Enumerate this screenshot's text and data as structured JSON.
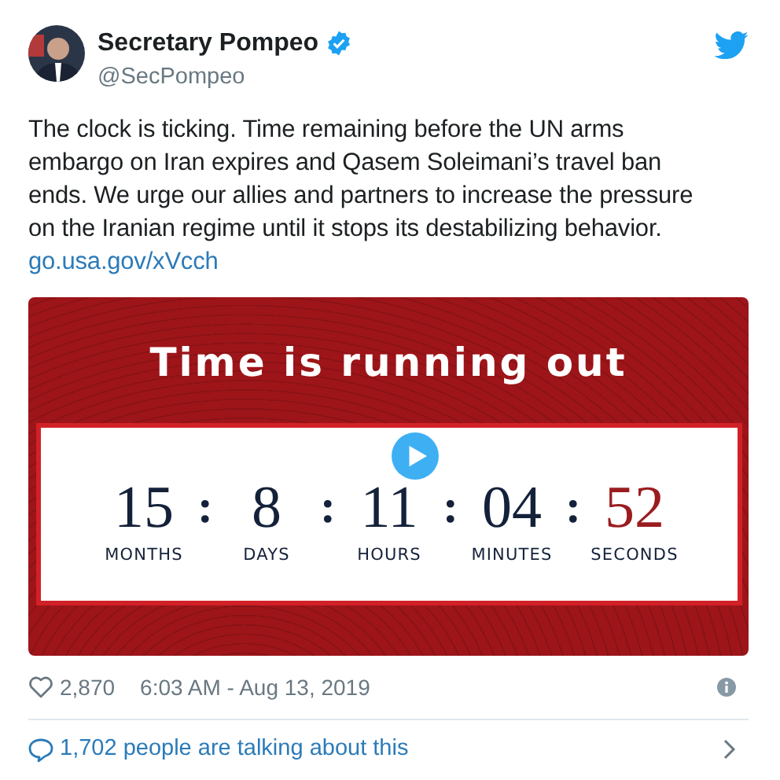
{
  "author": {
    "name": "Secretary Pompeo",
    "verified": true,
    "handle": "@SecPompeo"
  },
  "tweet": {
    "text": "The clock is ticking. Time remaining before the UN arms embargo on Iran expires and Qasem Soleimani’s travel ban ends. We urge our allies and partners to increase the pressure on the Iranian regime until it stops its destabilizing behavior.",
    "link": "go.usa.gov/xVcch"
  },
  "media": {
    "kind": "video",
    "title": "Time is running out",
    "separators": [
      ":",
      ":",
      ":",
      ":"
    ],
    "countdown": [
      {
        "value": "15",
        "unit": "MONTHS",
        "highlight": false
      },
      {
        "value": "8",
        "unit": "DAYS",
        "highlight": false
      },
      {
        "value": "11",
        "unit": "HOURS",
        "highlight": false
      },
      {
        "value": "04",
        "unit": "MINUTES",
        "highlight": false
      },
      {
        "value": "52",
        "unit": "SECONDS",
        "highlight": true
      }
    ]
  },
  "footer": {
    "likes": "2,870",
    "timestamp": "6:03 AM - Aug 13, 2019"
  },
  "conversation": "1,702 people are talking about this"
}
